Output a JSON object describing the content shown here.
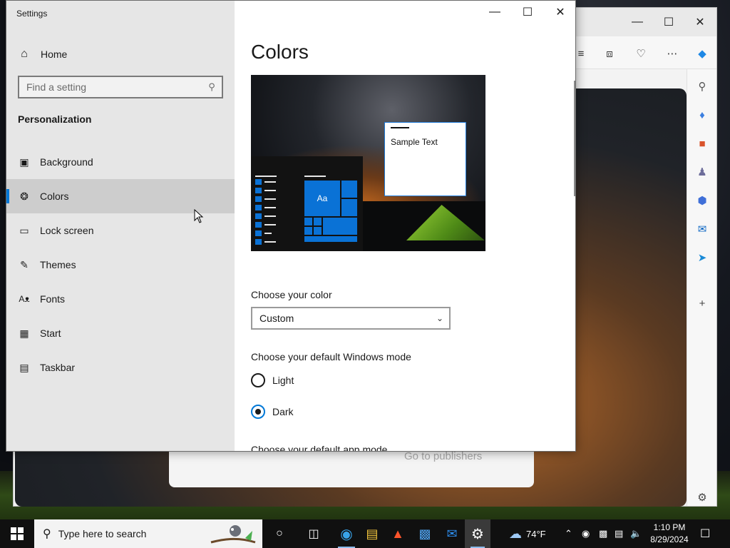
{
  "settings": {
    "app_title": "Settings",
    "home_label": "Home",
    "search_placeholder": "Find a setting",
    "section_title": "Personalization",
    "nav_items": [
      {
        "label": "Background",
        "icon": "image-icon"
      },
      {
        "label": "Colors",
        "icon": "palette-icon",
        "active": true
      },
      {
        "label": "Lock screen",
        "icon": "lock-screen-icon"
      },
      {
        "label": "Themes",
        "icon": "themes-icon"
      },
      {
        "label": "Fonts",
        "icon": "fonts-icon"
      },
      {
        "label": "Start",
        "icon": "start-icon"
      },
      {
        "label": "Taskbar",
        "icon": "taskbar-icon"
      }
    ],
    "page_title": "Colors",
    "preview_sample_text": "Sample Text",
    "preview_tile_text": "Aa",
    "choose_color_label": "Choose your color",
    "choose_color_value": "Custom",
    "windows_mode_label": "Choose your default Windows mode",
    "mode_options": [
      {
        "label": "Light",
        "checked": false
      },
      {
        "label": "Dark",
        "checked": true
      }
    ],
    "app_mode_label": "Choose your default app mode",
    "accent_color": "#0078d7"
  },
  "browser": {
    "card_link": "Go to publishers"
  },
  "taskbar": {
    "search_placeholder": "Type here to search",
    "weather_temp": "74°F",
    "time": "1:10 PM",
    "date": "8/29/2024"
  }
}
